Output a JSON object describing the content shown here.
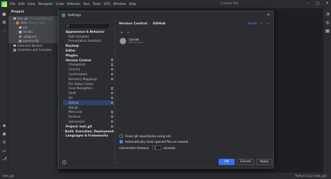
{
  "menubar": {
    "items": [
      "File",
      "Edit",
      "View",
      "Navigate",
      "Code",
      "Refactor",
      "Run",
      "Tools",
      "VCS",
      "Window",
      "Help"
    ],
    "center_text": "Current File"
  },
  "project": {
    "title": "Project",
    "tree": [
      {
        "label": "test_git",
        "dim": "D:\\Code\\test_git",
        "kind": "folder",
        "sel": true
      },
      {
        "label": "venv",
        "dim": "library root",
        "kind": "venv",
        "sel": true
      },
      {
        "label": "Lib",
        "dim": "",
        "kind": "folder",
        "sel": true
      },
      {
        "label": "Scripts",
        "dim": "",
        "kind": "folder",
        "sel": true
      },
      {
        "label": ".gitignore",
        "dim": "",
        "kind": "file",
        "sel": true
      },
      {
        "label": "pyvenv.cfg",
        "dim": "",
        "kind": "file",
        "sel": true
      },
      {
        "label": "External Libraries",
        "dim": "",
        "kind": "folder",
        "sel": false
      },
      {
        "label": "Scratches and Consoles",
        "dim": "",
        "kind": "file",
        "sel": false
      }
    ]
  },
  "dialog": {
    "title": "Settings",
    "search_placeholder": "Q",
    "breadcrumb": [
      "Version Control",
      "GitHub"
    ],
    "reset_label": "Reset",
    "nav_back": "←",
    "nav_fwd": "→",
    "toolbar": [
      "+",
      "−"
    ],
    "tree": [
      {
        "label": "Appearance & Behavior",
        "bold": true,
        "indent": 1,
        "arrow": "›"
      },
      {
        "label": "Path Variables",
        "indent": 2
      },
      {
        "label": "Presentation Assistant",
        "indent": 2
      },
      {
        "label": "Keymap",
        "bold": true,
        "indent": 1
      },
      {
        "label": "Editor",
        "bold": true,
        "indent": 1,
        "arrow": "›"
      },
      {
        "label": "Plugins",
        "bold": true,
        "indent": 1
      },
      {
        "label": "Version Control",
        "bold": true,
        "indent": 1,
        "arrow": "⌄",
        "side": true
      },
      {
        "label": "Changelists",
        "indent": 2,
        "side": true
      },
      {
        "label": "Commit",
        "indent": 2,
        "side": true
      },
      {
        "label": "Confirmation",
        "indent": 2,
        "side": true
      },
      {
        "label": "Directory Mappings",
        "indent": 2,
        "side": true
      },
      {
        "label": "File Status Colors",
        "indent": 2
      },
      {
        "label": "Issue Navigation",
        "indent": 2,
        "side": true
      },
      {
        "label": "Shelf",
        "indent": 2,
        "side": true
      },
      {
        "label": "Git",
        "indent": 2,
        "side": true
      },
      {
        "label": "GitHub",
        "indent": 2,
        "sel": true,
        "side": true
      },
      {
        "label": "GitLab",
        "indent": 2
      },
      {
        "label": "Mercurial",
        "indent": 2,
        "side": true
      },
      {
        "label": "Perforce",
        "indent": 2,
        "side": true
      },
      {
        "label": "Subversion",
        "indent": 2,
        "arrow": "›",
        "side": true
      },
      {
        "label": "Project: test_git",
        "bold": true,
        "indent": 1,
        "arrow": "›",
        "side": true
      },
      {
        "label": "Build, Execution, Deployment",
        "bold": true,
        "indent": 1,
        "arrow": "›"
      },
      {
        "label": "Languages & Frameworks",
        "bold": true,
        "indent": 1,
        "arrow": "›"
      }
    ],
    "account": {
      "name": "五月の雨",
      "server": "github.com"
    },
    "options": {
      "clone_ssh": "Clone git repositories using ssh",
      "mark_viewed": "Automatically mark opened files as viewed",
      "timeout_label": "Connection timeout:",
      "timeout_value": "5",
      "timeout_unit": "seconds"
    },
    "buttons": {
      "help": "?",
      "ok": "OK",
      "cancel": "Cancel",
      "apply": "Apply"
    }
  },
  "status": {
    "left": "test_git",
    "right": "Python 3.12 (test_git)"
  }
}
